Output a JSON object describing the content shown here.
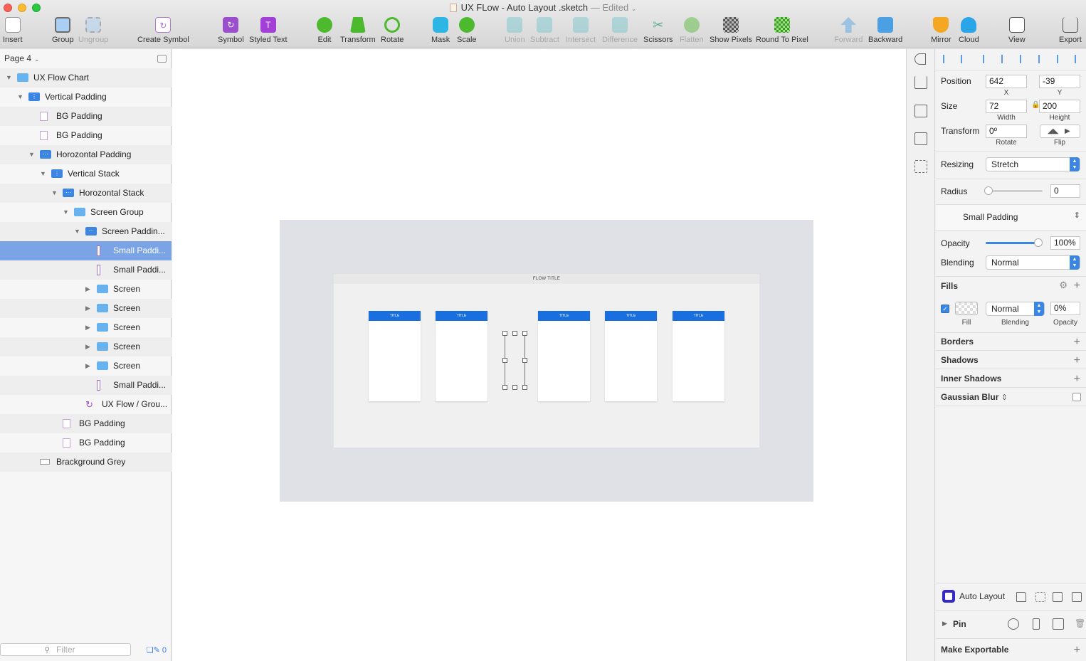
{
  "window": {
    "title": "UX FLow - Auto Layout .sketch",
    "edited": "— Edited"
  },
  "toolbar": [
    {
      "label": "Insert",
      "icon": "plus-icon",
      "disabled": false
    },
    {
      "label": "Group",
      "icon": "group-icon",
      "disabled": false
    },
    {
      "label": "Ungroup",
      "icon": "ungroup-icon",
      "disabled": true
    },
    {
      "label": "Create Symbol",
      "icon": "symbol-create-icon",
      "disabled": false
    },
    {
      "label": "Symbol",
      "icon": "symbol-icon",
      "disabled": false
    },
    {
      "label": "Styled Text",
      "icon": "styled-text-icon",
      "disabled": false
    },
    {
      "label": "Edit",
      "icon": "edit-icon",
      "disabled": false
    },
    {
      "label": "Transform",
      "icon": "transform-icon",
      "disabled": false
    },
    {
      "label": "Rotate",
      "icon": "rotate-icon",
      "disabled": false
    },
    {
      "label": "Mask",
      "icon": "mask-icon",
      "disabled": false
    },
    {
      "label": "Scale",
      "icon": "scale-icon",
      "disabled": false
    },
    {
      "label": "Union",
      "icon": "union-icon",
      "disabled": true
    },
    {
      "label": "Subtract",
      "icon": "subtract-icon",
      "disabled": true
    },
    {
      "label": "Intersect",
      "icon": "intersect-icon",
      "disabled": true
    },
    {
      "label": "Difference",
      "icon": "difference-icon",
      "disabled": true
    },
    {
      "label": "Scissors",
      "icon": "scissors-icon",
      "disabled": false
    },
    {
      "label": "Flatten",
      "icon": "flatten-icon",
      "disabled": true
    },
    {
      "label": "Show Pixels",
      "icon": "pixels-icon",
      "disabled": false
    },
    {
      "label": "Round To Pixel",
      "icon": "round-pixel-icon",
      "disabled": false
    },
    {
      "label": "Forward",
      "icon": "forward-icon",
      "disabled": true
    },
    {
      "label": "Backward",
      "icon": "backward-icon",
      "disabled": false
    },
    {
      "label": "Mirror",
      "icon": "mirror-icon",
      "disabled": false
    },
    {
      "label": "Cloud",
      "icon": "cloud-icon",
      "disabled": false
    },
    {
      "label": "View",
      "icon": "view-icon",
      "disabled": false
    },
    {
      "label": "Export",
      "icon": "export-icon",
      "disabled": false
    }
  ],
  "layers": {
    "page": "Page 4",
    "items": [
      {
        "name": "UX Flow Chart",
        "icon": "folder-icon"
      },
      {
        "name": "Vertical Padding",
        "icon": "vertical-stack-icon"
      },
      {
        "name": "BG Padding",
        "icon": "rectangle-icon"
      },
      {
        "name": "BG Padding",
        "icon": "rectangle-icon"
      },
      {
        "name": "Horozontal Padding",
        "icon": "horizontal-stack-icon"
      },
      {
        "name": "Vertical Stack",
        "icon": "vertical-stack-icon"
      },
      {
        "name": "Horozontal Stack",
        "icon": "horizontal-stack-icon"
      },
      {
        "name": "Screen Group",
        "icon": "folder-icon"
      },
      {
        "name": "Screen Paddin...",
        "icon": "horizontal-stack-icon"
      },
      {
        "name": "Small Paddi...",
        "icon": "thin-rectangle-icon",
        "selected": true
      },
      {
        "name": "Small Paddi...",
        "icon": "thin-rectangle-icon"
      },
      {
        "name": "Screen",
        "icon": "folder-icon"
      },
      {
        "name": "Screen",
        "icon": "folder-icon"
      },
      {
        "name": "Screen",
        "icon": "folder-icon"
      },
      {
        "name": "Screen",
        "icon": "folder-icon"
      },
      {
        "name": "Screen",
        "icon": "folder-icon"
      },
      {
        "name": "Small Paddi...",
        "icon": "thin-rectangle-icon"
      },
      {
        "name": "UX Flow / Grou...",
        "icon": "symbol-instance-icon"
      },
      {
        "name": "BG Padding",
        "icon": "rectangle-icon"
      },
      {
        "name": "BG Padding",
        "icon": "rectangle-icon"
      },
      {
        "name": "Brackground Grey",
        "icon": "grey-rectangle-icon"
      }
    ],
    "filter_placeholder": "Filter",
    "filter_count": "0"
  },
  "canvas": {
    "flow_title": "FLOW TITLE",
    "screen_label": "TITLE",
    "screen_count": 5
  },
  "inspector": {
    "position_label": "Position",
    "x": "642",
    "y": "-39",
    "x_label": "X",
    "y_label": "Y",
    "size_label": "Size",
    "width": "72",
    "height": "200",
    "width_label": "Width",
    "height_label": "Height",
    "transform_label": "Transform",
    "rotate": "0º",
    "rotate_label": "Rotate",
    "flip_label": "Flip",
    "resizing_label": "Resizing",
    "resizing": "Stretch",
    "radius_label": "Radius",
    "radius": "0",
    "shared_style": "Small Padding",
    "opacity_label": "Opacity",
    "opacity": "100%",
    "opacity_level": 1.0,
    "blending_label": "Blending",
    "blending": "Normal",
    "fills_title": "Fills",
    "fill_blending": "Normal",
    "fill_opacity": "0%",
    "fill_label": "Fill",
    "fill_blending_label": "Blending",
    "fill_opacity_label": "Opacity",
    "borders_title": "Borders",
    "shadows_title": "Shadows",
    "inner_shadows_title": "Inner Shadows",
    "gaussian_blur_title": "Gaussian Blur",
    "auto_layout_label": "Auto Layout",
    "pin_label": "Pin",
    "make_exportable": "Make Exportable"
  },
  "colors": {
    "accent": "#3b86e2",
    "selection": "#7aa4e6",
    "screen_header": "#1a6fe0"
  }
}
